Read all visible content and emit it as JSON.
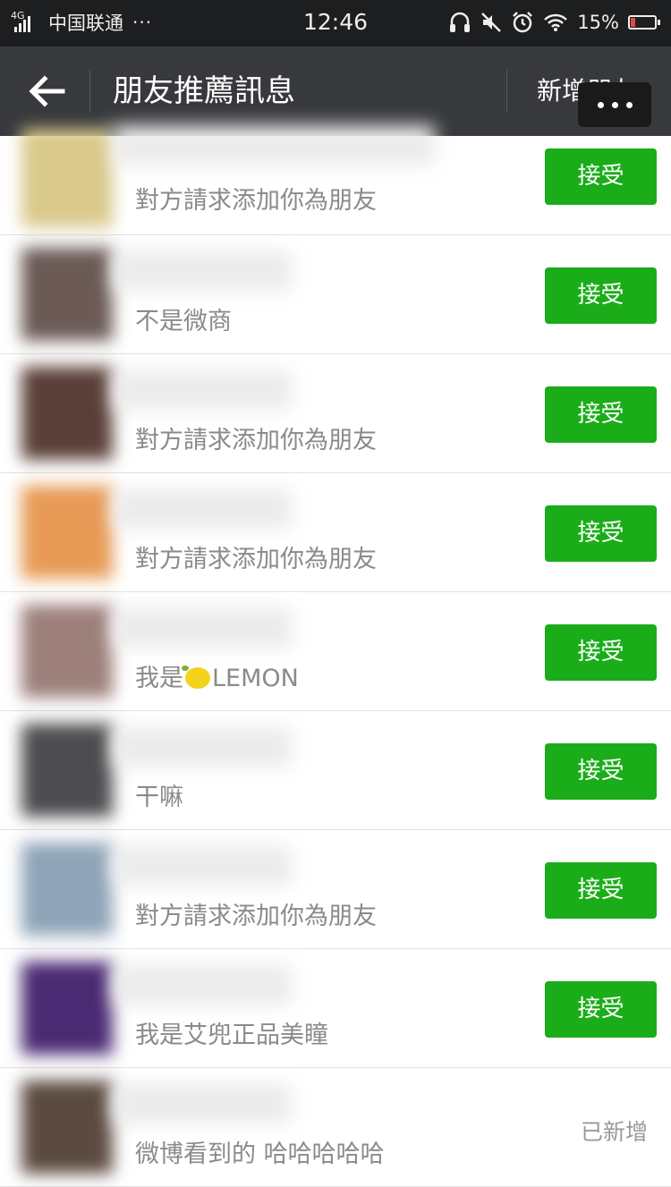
{
  "status_bar": {
    "network": "4G",
    "carrier": "中国联通",
    "more": "···",
    "time": "12:46",
    "battery": "15%",
    "icons": [
      "headphones-icon",
      "mute-icon",
      "alarm-icon",
      "wifi-icon",
      "battery-icon"
    ]
  },
  "header": {
    "back_icon": "arrow-left-icon",
    "title": "朋友推薦訊息",
    "action": "新增朋友",
    "menu_icon": "more-dots-icon"
  },
  "requests": [
    {
      "message": "對方請求添加你為朋友",
      "button": "接受",
      "avatar_color": "#d9c98a"
    },
    {
      "message": "不是微商",
      "button": "接受",
      "avatar_color": "#6b5a55"
    },
    {
      "message": "對方請求添加你為朋友",
      "button": "接受",
      "avatar_color": "#5a3f38"
    },
    {
      "message": "對方請求添加你為朋友",
      "button": "接受",
      "avatar_color": "#e79a55"
    },
    {
      "message_prefix": "我是",
      "message_suffix": "LEMON",
      "message_emoji": "lemon-icon",
      "button": "接受",
      "avatar_color": "#9c7f7a"
    },
    {
      "message": "干嘛",
      "button": "接受",
      "avatar_color": "#4d4d50"
    },
    {
      "message": "對方請求添加你為朋友",
      "button": "接受",
      "avatar_color": "#8fa4b8"
    },
    {
      "message": "我是艾兜正品美瞳",
      "button": "接受",
      "avatar_color": "#4a2a73"
    },
    {
      "message": "微博看到的 哈哈哈哈哈",
      "status": "已新增",
      "avatar_color": "#5b4a40"
    }
  ],
  "colors": {
    "accept_green": "#1aad19",
    "topbar": "#37393d",
    "statusbar": "#1d1e20"
  }
}
